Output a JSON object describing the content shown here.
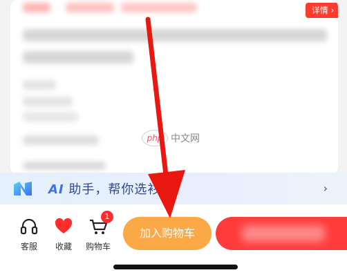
{
  "product": {
    "details_label": "详情 ›"
  },
  "watermark": {
    "logo_text": "php",
    "site_text": "中文网"
  },
  "ai_assistant": {
    "prefix": "AI",
    "text": " 助手，帮你选衫",
    "chevron": "›"
  },
  "bottom_bar": {
    "service_label": "客服",
    "favorite_label": "收藏",
    "cart_label": "购物车",
    "cart_badge": "1",
    "add_to_cart_label": "加入购物车"
  },
  "colors": {
    "accent_red": "#ff3b2f",
    "add_cart_orange": "#fba847",
    "arrow_red": "#e8170f"
  },
  "icons": [
    "headset-icon",
    "heart-icon",
    "cart-icon",
    "ai-logo-icon",
    "arrow-annotation"
  ]
}
